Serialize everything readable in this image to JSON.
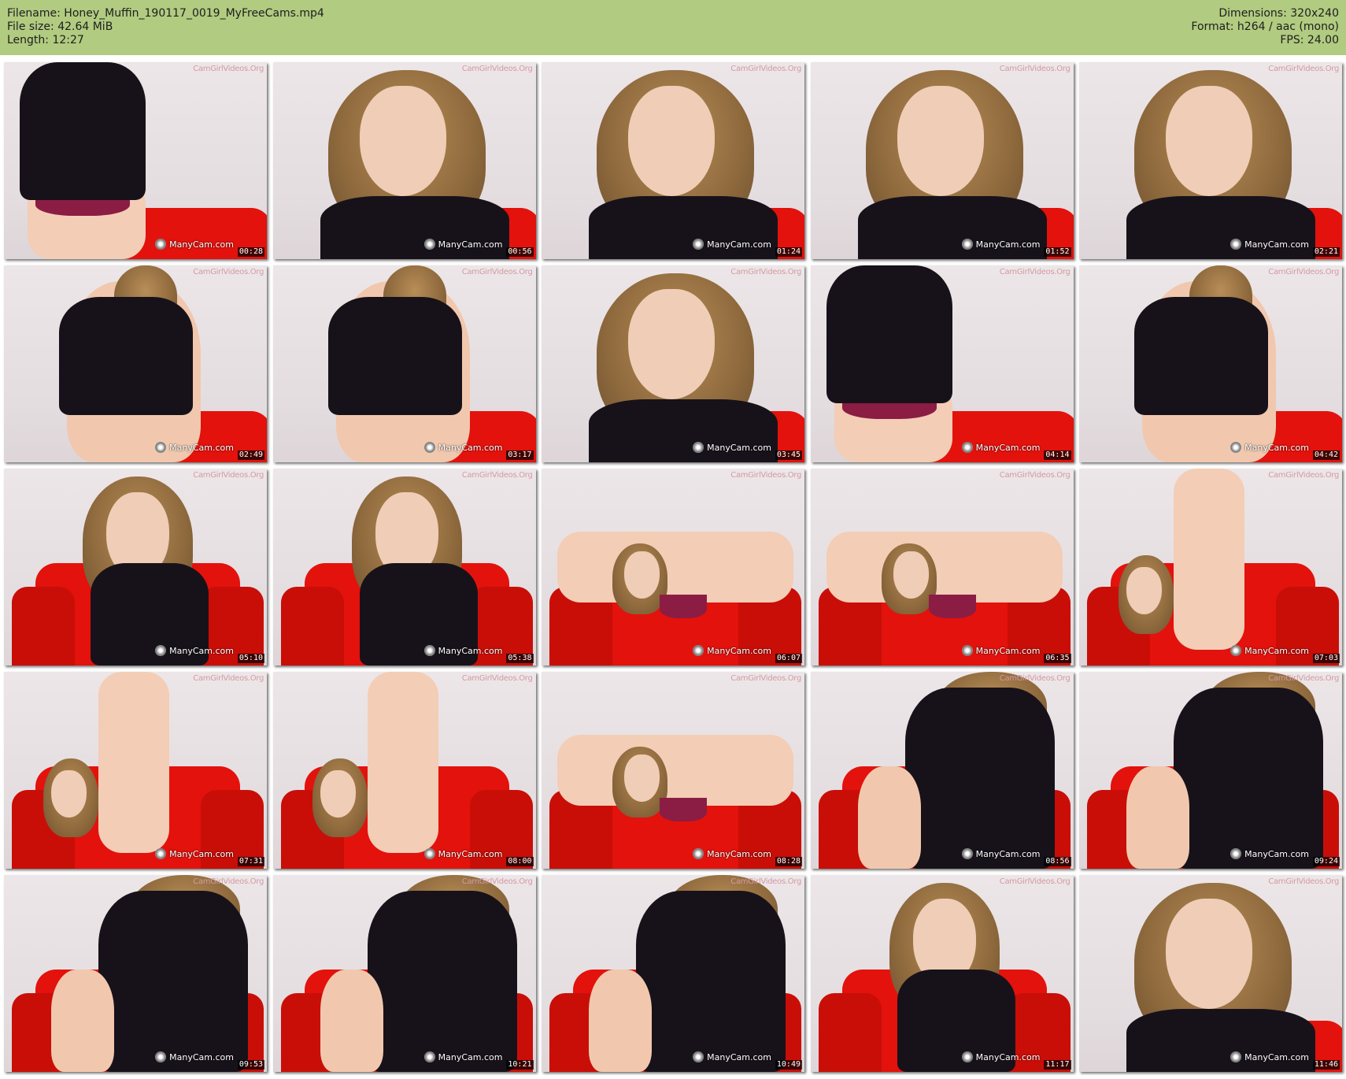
{
  "header": {
    "filename_line": "Filename: Honey_Muffin_190117_0019_MyFreeCams.mp4",
    "filesize_line": "File size: 42.64 MiB",
    "length_line": "Length: 12:27",
    "dimensions_line": "Dimensions: 320x240",
    "format_line": "Format: h264 / aac (mono)",
    "fps_line": "FPS: 24.00"
  },
  "colors": {
    "header_bg": "#b1cb80",
    "chair_red": "#e3120c"
  },
  "watermarks": {
    "top": "CamGirlVideos.Org",
    "bottom": "ManyCam.com"
  },
  "thumbnails": [
    {
      "time": "00:28"
    },
    {
      "time": "00:56"
    },
    {
      "time": "01:24"
    },
    {
      "time": "01:52"
    },
    {
      "time": "02:21"
    },
    {
      "time": "02:49"
    },
    {
      "time": "03:17"
    },
    {
      "time": "03:45"
    },
    {
      "time": "04:14"
    },
    {
      "time": "04:42"
    },
    {
      "time": "05:10"
    },
    {
      "time": "05:38"
    },
    {
      "time": "06:07"
    },
    {
      "time": "06:35"
    },
    {
      "time": "07:03"
    },
    {
      "time": "07:31"
    },
    {
      "time": "08:00"
    },
    {
      "time": "08:28"
    },
    {
      "time": "08:56"
    },
    {
      "time": "09:24"
    },
    {
      "time": "09:53"
    },
    {
      "time": "10:21"
    },
    {
      "time": "10:49"
    },
    {
      "time": "11:17"
    },
    {
      "time": "11:46"
    }
  ]
}
